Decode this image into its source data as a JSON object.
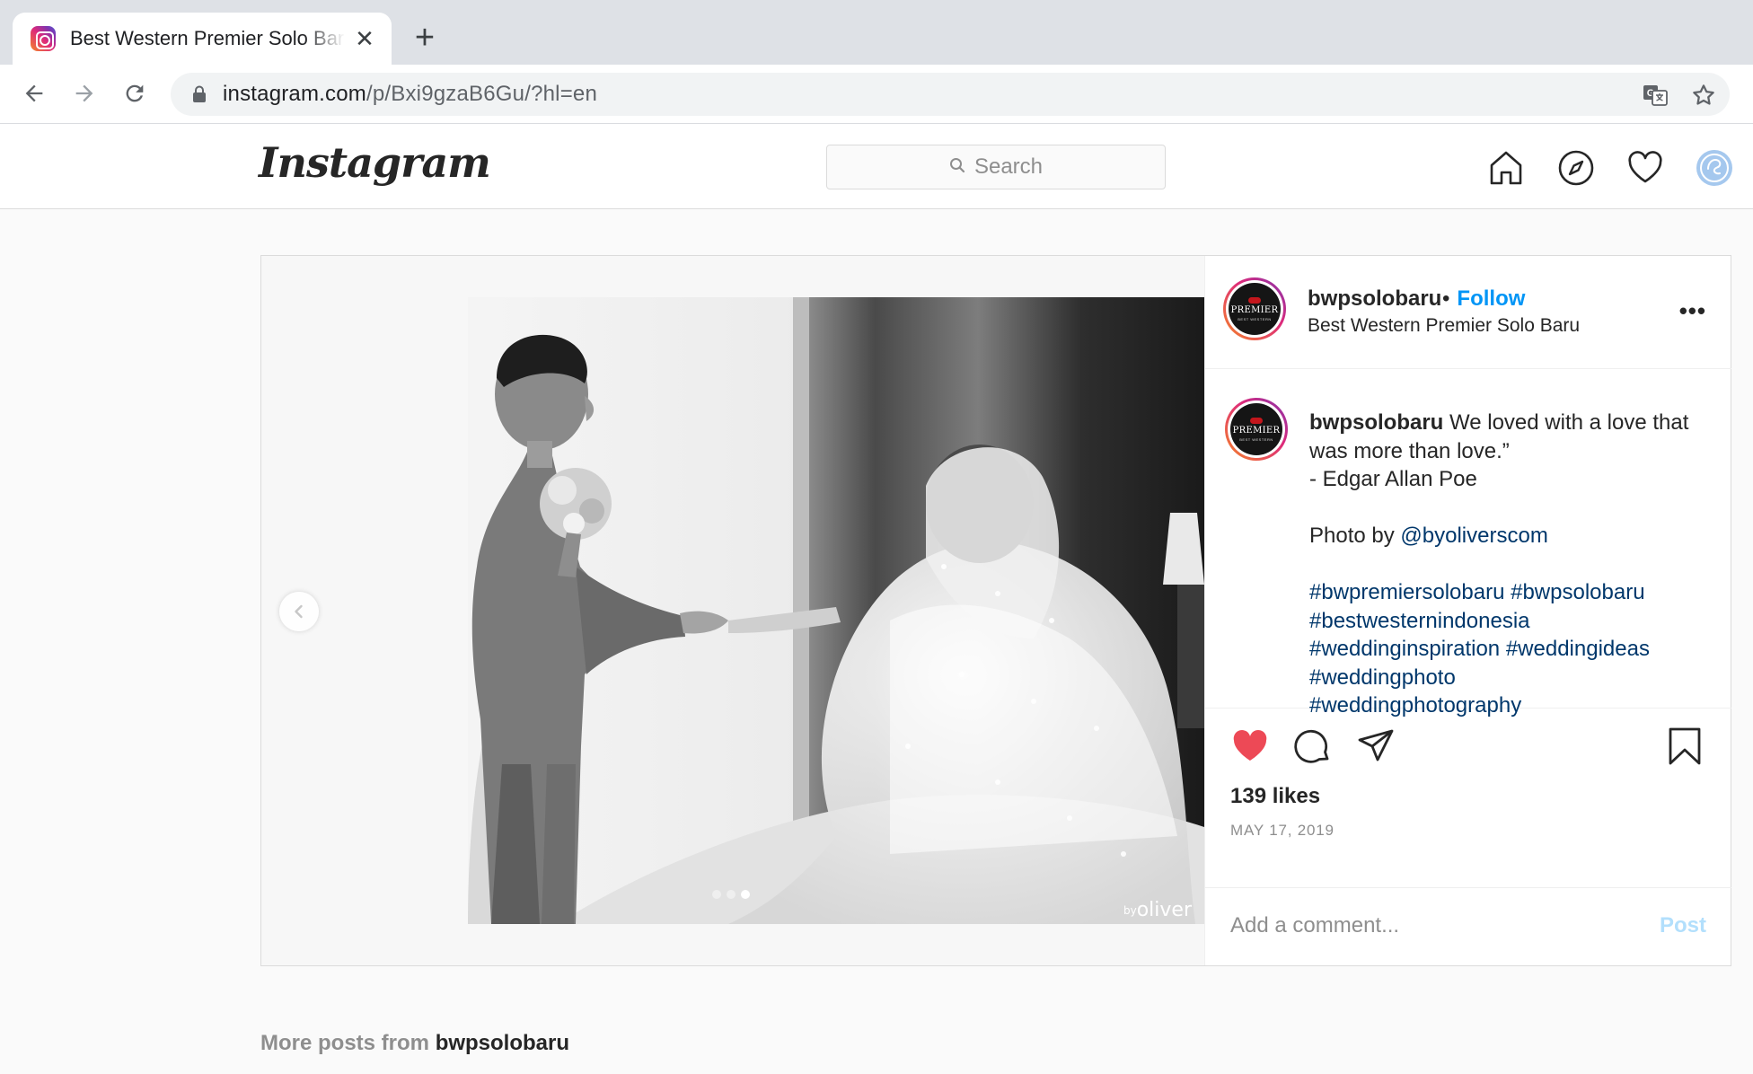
{
  "browser": {
    "tab_title": "Best Western Premier Solo Baru | Instagram",
    "close_glyph": "✕",
    "newtab_glyph": "+",
    "url_host": "instagram.com",
    "url_path": "/p/Bxi9gzaB6Gu/?hl=en"
  },
  "header": {
    "logo_text": "Instagram",
    "search_placeholder": "Search"
  },
  "post": {
    "username": "bwpsolobaru",
    "follow_separator": "•",
    "follow_label": "Follow",
    "location": "Best Western Premier Solo Baru",
    "more_glyph": "•••",
    "avatar": {
      "brand": "PREMIER",
      "sub": "BEST WESTERN"
    },
    "caption": {
      "username": "bwpsolobaru",
      "line1": "We loved with a love that was more than love.”",
      "line2": "- Edgar Allan Poe",
      "photo_by_prefix": "Photo by ",
      "photo_by_handle": "@byoliverscom",
      "hashtags_1": "#bwpremiersolobaru #bwpsolobaru",
      "hashtags_2": "#bestwesternindonesia",
      "hashtags_3": "#weddinginspiration #weddingideas",
      "hashtags_4": "#weddingphoto",
      "hashtags_5": "#weddingphotography"
    },
    "likes": "139 likes",
    "date": "MAY 17, 2019",
    "comment_placeholder": "Add a comment...",
    "post_label": "Post",
    "watermark_prefix": "by",
    "watermark_name": "oliver",
    "carousel": {
      "count": 3,
      "active_index": 2
    }
  },
  "more_posts": {
    "prefix": "More posts from ",
    "username": "bwpsolobaru"
  },
  "colors": {
    "follow_blue": "#0095f6",
    "hashtag_blue": "#00376b",
    "like_red": "#ed4956",
    "post_disabled": "#b2dffc"
  },
  "icons": [
    "back-arrow-icon",
    "forward-arrow-icon",
    "reload-icon",
    "lock-icon",
    "translate-icon",
    "star-icon",
    "search-icon",
    "home-icon",
    "explore-icon",
    "heart-icon",
    "profile-avatar-icon",
    "chevron-left-icon",
    "like-filled-icon",
    "comment-icon",
    "share-icon",
    "bookmark-icon"
  ]
}
